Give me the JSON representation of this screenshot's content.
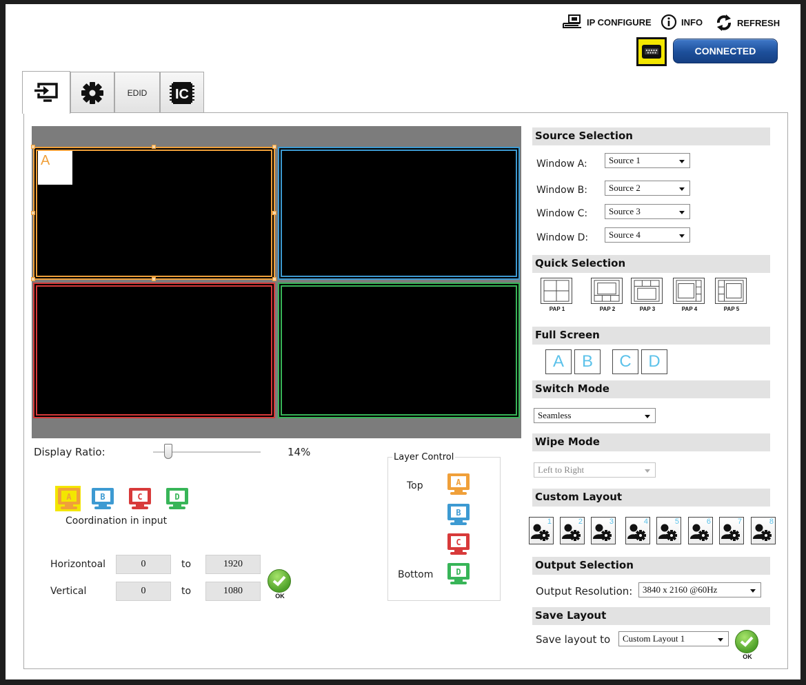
{
  "toolbar": {
    "ip_configure": "IP CONFIGURE",
    "info": "INFO",
    "refresh": "REFRESH",
    "connection_status": "CONNECTED"
  },
  "tabs": [
    {
      "name": "input-tab",
      "icon": "input-icon",
      "label": "",
      "active": true
    },
    {
      "name": "settings-tab",
      "icon": "gear-icon",
      "label": "",
      "active": false
    },
    {
      "name": "edid-tab",
      "icon": "",
      "label": "EDID",
      "active": false
    },
    {
      "name": "ic-tab",
      "icon": "ic-chip-icon",
      "label": "",
      "active": false
    }
  ],
  "preview": {
    "selected_window_label": "A",
    "window_colors": {
      "A": "#f0a03a",
      "B": "#3d9ad2",
      "C": "#d83a3a",
      "D": "#38b558"
    }
  },
  "display_ratio": {
    "label": "Display Ratio:",
    "value": "14%",
    "percent": 14
  },
  "coordination": {
    "caption": "Coordination in input",
    "monitors": [
      "A",
      "B",
      "C",
      "D"
    ],
    "selected": "A"
  },
  "coords": {
    "horizontal_label": "Horizontoal",
    "vertical_label": "Vertical",
    "to": "to",
    "h_from": "0",
    "h_to": "1920",
    "v_from": "0",
    "v_to": "1080",
    "ok": "OK"
  },
  "layer_control": {
    "legend": "Layer Control",
    "top": "Top",
    "bottom": "Bottom",
    "order": [
      "A",
      "B",
      "C",
      "D"
    ]
  },
  "source_selection": {
    "heading": "Source Selection",
    "rows": [
      {
        "label": "Window A:",
        "value": "Source 1"
      },
      {
        "label": "Window B:",
        "value": "Source 2"
      },
      {
        "label": "Window C:",
        "value": "Source 3"
      },
      {
        "label": "Window D:",
        "value": "Source 4"
      }
    ]
  },
  "quick_selection": {
    "heading": "Quick Selection",
    "presets": [
      "PAP 1",
      "PAP 2",
      "PAP 3",
      "PAP 4",
      "PAP 5"
    ]
  },
  "full_screen": {
    "heading": "Full Screen",
    "buttons": [
      "A",
      "B",
      "C",
      "D"
    ]
  },
  "switch_mode": {
    "heading": "Switch Mode",
    "value": "Seamless"
  },
  "wipe_mode": {
    "heading": "Wipe Mode",
    "value": "Left to Right"
  },
  "custom_layout": {
    "heading": "Custom Layout",
    "numbers": [
      "1",
      "2",
      "3",
      "4",
      "5",
      "6",
      "7",
      "8"
    ]
  },
  "output_selection": {
    "heading": "Output Selection",
    "label": "Output Resolution:",
    "value": "3840 x 2160 @60Hz"
  },
  "save_layout": {
    "heading": "Save Layout",
    "label": "Save layout to",
    "value": "Custom Layout 1",
    "ok": "OK"
  }
}
